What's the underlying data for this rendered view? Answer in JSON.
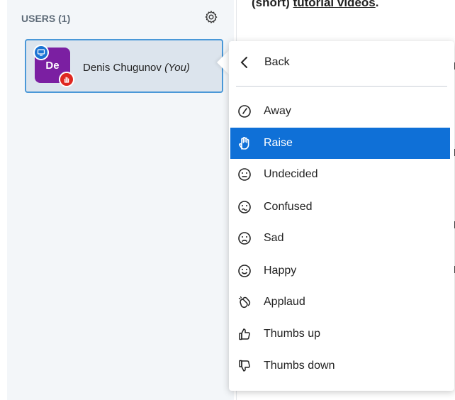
{
  "users_header": "USERS (1)",
  "user": {
    "initials": "De",
    "name": "Denis Chugunov",
    "you_label": "(You)"
  },
  "top_text": {
    "part1": "(short) ",
    "part2": "tutorial videos",
    "part3": "."
  },
  "menu": {
    "back_label": "Back",
    "items": [
      {
        "label": "Away",
        "icon": "clock-icon"
      },
      {
        "label": "Raise",
        "icon": "hand-icon",
        "active": true
      },
      {
        "label": "Undecided",
        "icon": "neutral-face-icon"
      },
      {
        "label": "Confused",
        "icon": "confused-face-icon"
      },
      {
        "label": "Sad",
        "icon": "sad-face-icon"
      },
      {
        "label": "Happy",
        "icon": "happy-face-icon"
      },
      {
        "label": "Applaud",
        "icon": "applaud-icon"
      },
      {
        "label": "Thumbs up",
        "icon": "thumbs-up-icon"
      },
      {
        "label": "Thumbs down",
        "icon": "thumbs-down-icon"
      }
    ]
  },
  "colors": {
    "accent": "#0f70d7",
    "avatar": "#7b1fa2",
    "status_badge": "#df2721",
    "card_border": "#4a98d8"
  }
}
